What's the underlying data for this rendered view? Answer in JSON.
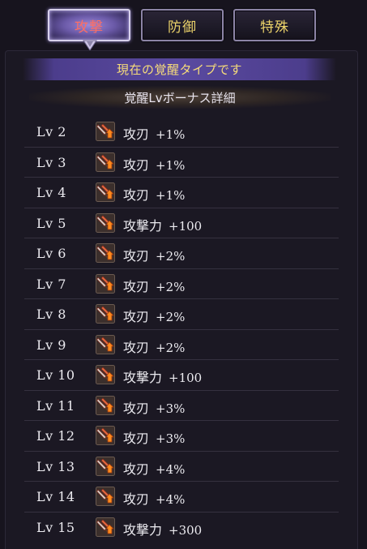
{
  "tabs": [
    {
      "label": "攻撃"
    },
    {
      "label": "防御"
    },
    {
      "label": "特殊"
    }
  ],
  "active_tab": "攻撃",
  "banner": "現在の覚醒タイプです",
  "subheader": "覚醒Lvボーナス詳細",
  "rows": [
    {
      "level": "Lv 2",
      "icon": "sword-buff-icon",
      "stat": "攻刃",
      "value": "+1%"
    },
    {
      "level": "Lv 3",
      "icon": "sword-buff-icon",
      "stat": "攻刃",
      "value": "+1%"
    },
    {
      "level": "Lv 4",
      "icon": "sword-buff-icon",
      "stat": "攻刃",
      "value": "+1%"
    },
    {
      "level": "Lv 5",
      "icon": "sword-buff-icon",
      "stat": "攻撃力",
      "value": "+100"
    },
    {
      "level": "Lv 6",
      "icon": "sword-buff-icon",
      "stat": "攻刃",
      "value": "+2%"
    },
    {
      "level": "Lv 7",
      "icon": "sword-buff-icon",
      "stat": "攻刃",
      "value": "+2%"
    },
    {
      "level": "Lv 8",
      "icon": "sword-buff-icon",
      "stat": "攻刃",
      "value": "+2%"
    },
    {
      "level": "Lv 9",
      "icon": "sword-buff-icon",
      "stat": "攻刃",
      "value": "+2%"
    },
    {
      "level": "Lv 10",
      "icon": "sword-buff-icon",
      "stat": "攻撃力",
      "value": "+100"
    },
    {
      "level": "Lv 11",
      "icon": "sword-buff-icon",
      "stat": "攻刃",
      "value": "+3%"
    },
    {
      "level": "Lv 12",
      "icon": "sword-buff-icon",
      "stat": "攻刃",
      "value": "+3%"
    },
    {
      "level": "Lv 13",
      "icon": "sword-buff-icon",
      "stat": "攻刃",
      "value": "+4%"
    },
    {
      "level": "Lv 14",
      "icon": "sword-buff-icon",
      "stat": "攻刃",
      "value": "+4%"
    },
    {
      "level": "Lv 15",
      "icon": "sword-buff-icon",
      "stat": "攻撃力",
      "value": "+300"
    }
  ],
  "colors": {
    "active_tab_text": "#ff6e62",
    "tab_text": "#ecd36a",
    "banner_text": "#f6dc7a",
    "banner_bg": "#5a4aa0",
    "row_text": "#ecebf0"
  }
}
